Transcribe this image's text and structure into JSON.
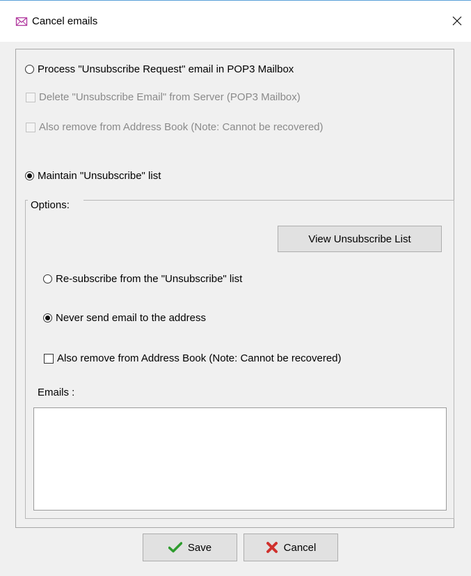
{
  "window": {
    "title": "Cancel emails",
    "icon": "envelope-icon",
    "close_glyph": "✕"
  },
  "pop3_section": {
    "radio_label": "Process \"Unsubscribe Request\" email in POP3 Mailbox",
    "radio_selected": false,
    "delete_label": "Delete \"Unsubscribe Email\" from Server (POP3 Mailbox)",
    "delete_checked": false,
    "delete_enabled": false,
    "remove_label": "Also remove from Address Book (Note: Cannot be recovered)",
    "remove_checked": false,
    "remove_enabled": false
  },
  "maintain_section": {
    "radio_label": "Maintain \"Unsubscribe\" list",
    "radio_selected": true
  },
  "options": {
    "legend": "Options:",
    "view_button": "View Unsubscribe List",
    "resubscribe_label": "Re-subscribe from the \"Unsubscribe\" list",
    "resubscribe_selected": false,
    "never_send_label": "Never send email to the address",
    "never_send_selected": true,
    "remove_label": "Also remove from Address Book (Note: Cannot be recovered)",
    "remove_checked": false,
    "emails_label": "Emails :",
    "emails_value": ""
  },
  "buttons": {
    "save_label": "Save",
    "save_icon": "checkmark-icon",
    "cancel_label": "Cancel",
    "cancel_icon": "x-cross-icon"
  },
  "colors": {
    "save_icon": "#2e9c2e",
    "cancel_icon": "#d0312d",
    "title_icon": "#b0389e"
  }
}
